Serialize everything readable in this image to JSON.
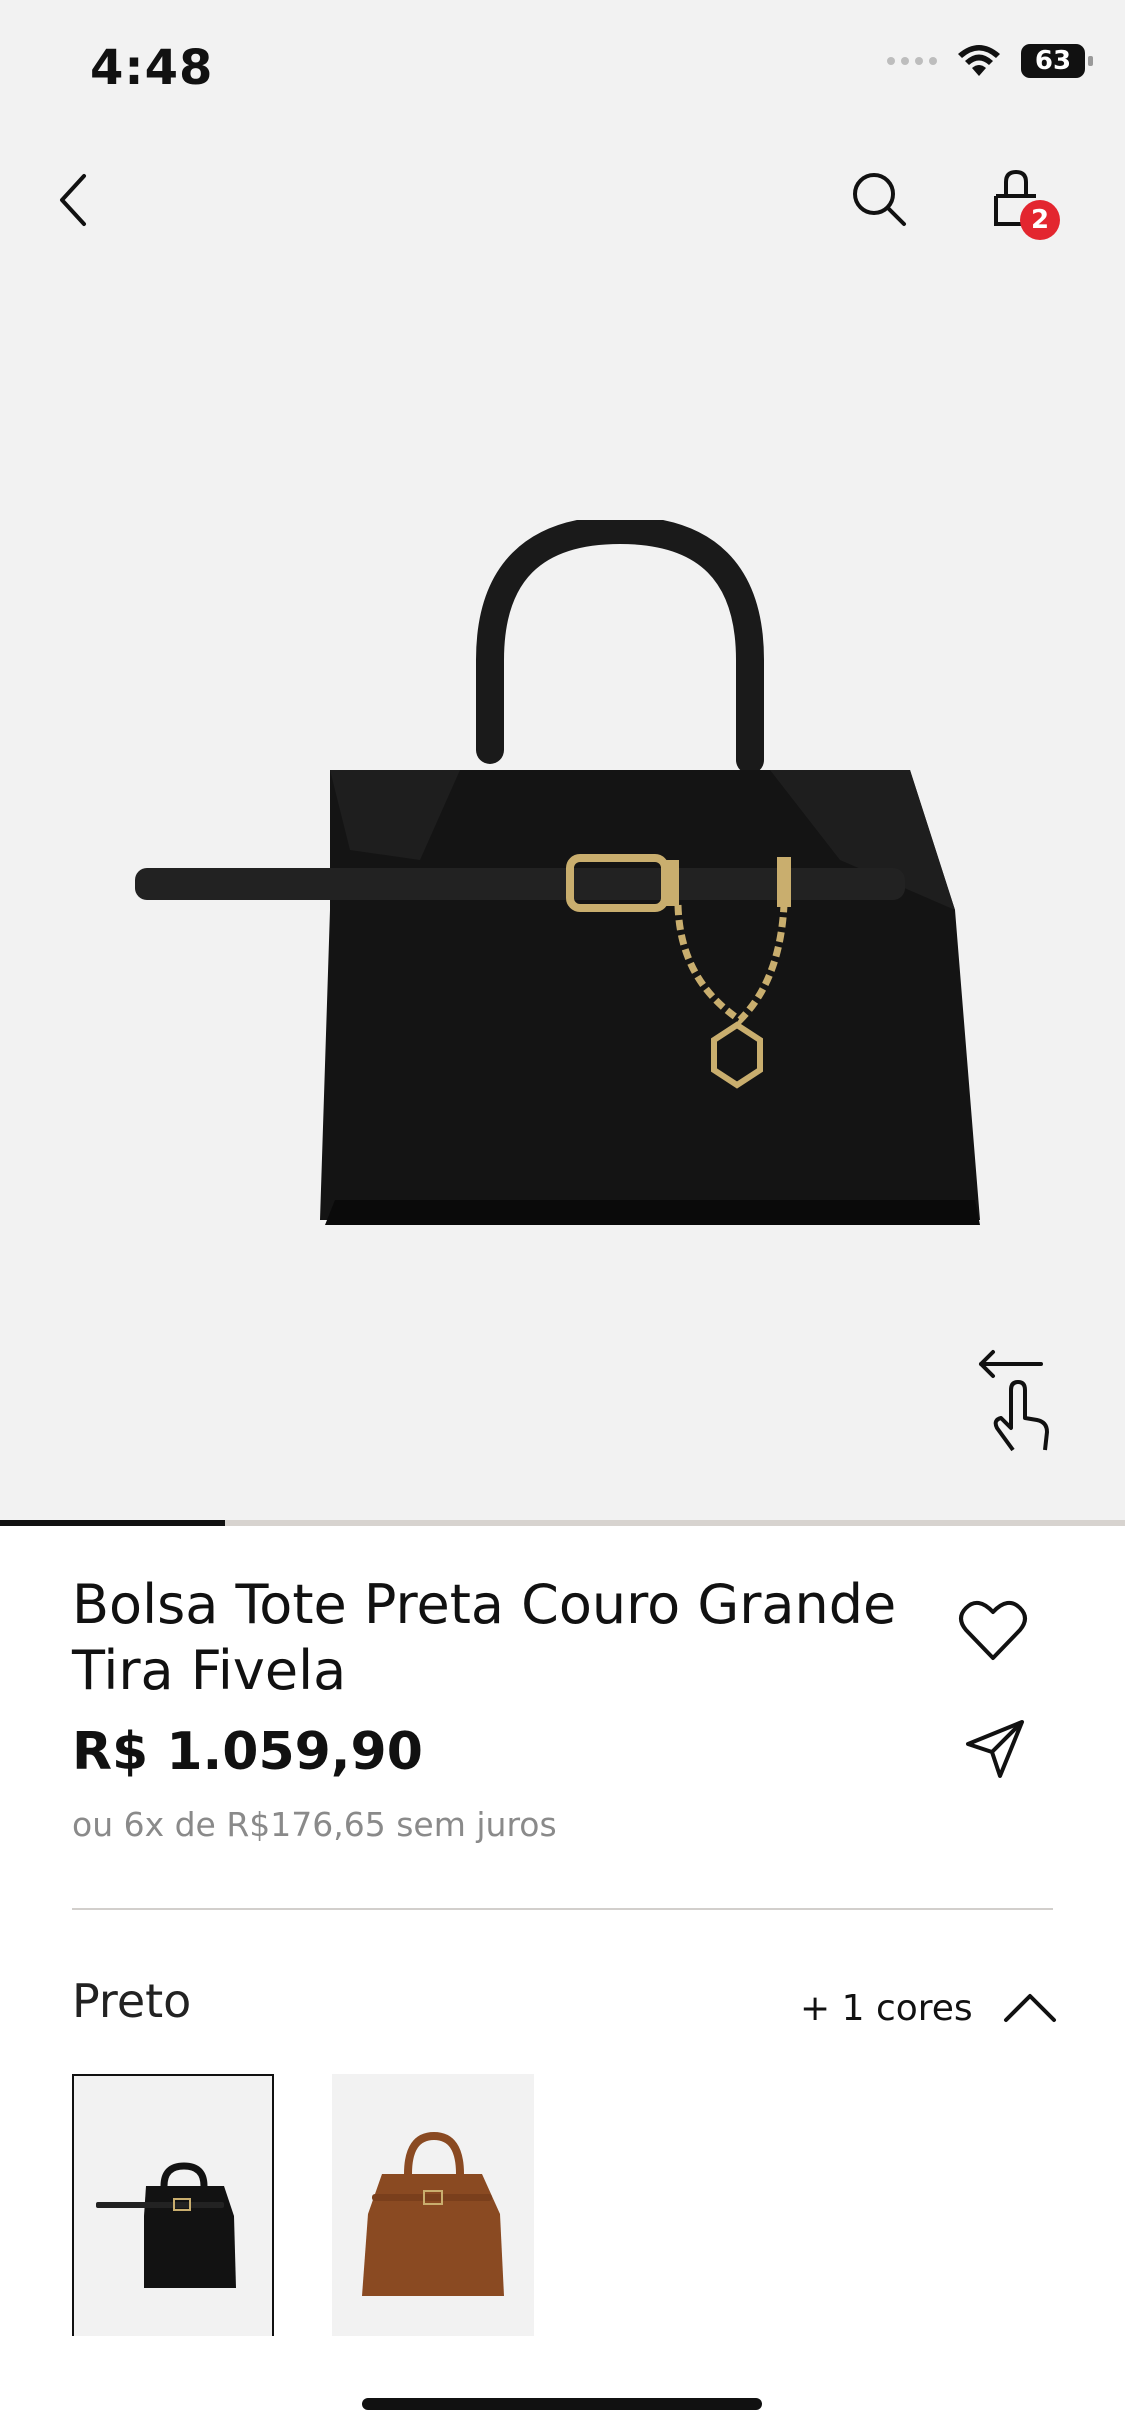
{
  "status_bar": {
    "time": "4:48",
    "battery": "63"
  },
  "header": {
    "cart_count": "2",
    "icons": [
      "back-icon",
      "search-icon",
      "bag-icon"
    ]
  },
  "gallery": {
    "progress": 0.2,
    "swipe_icon": "swipe-left-icon"
  },
  "product": {
    "title": "Bolsa Tote Preta Couro Grande Tira Fivela",
    "price": "R$ 1.059,90",
    "installments": "ou 6x de R$176,65 sem juros"
  },
  "colors": {
    "selected_label": "Preto",
    "more_label": "+ 1 cores",
    "swatches": [
      {
        "name": "black",
        "color": "#121212"
      },
      {
        "name": "brown",
        "color": "#8a4a22"
      }
    ]
  },
  "accent_color": "#e3262f"
}
